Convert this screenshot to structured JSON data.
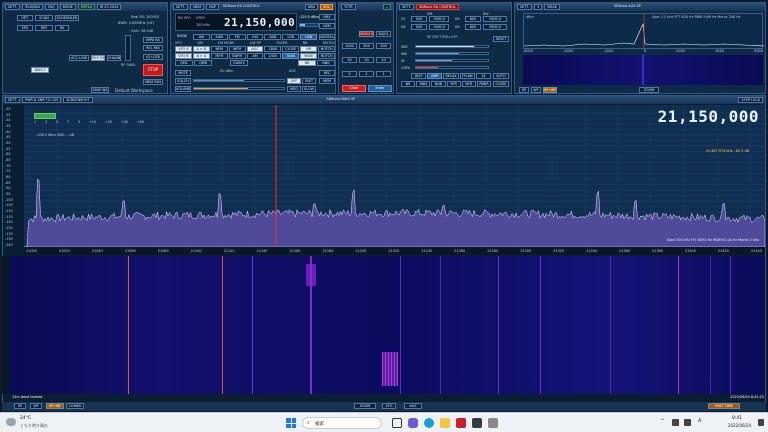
{
  "top_bar": {
    "left_btns": [
      "SETT.",
      "R2IQ3KU",
      "FAQ",
      "MODE"
    ],
    "hardware": "RSP1A",
    "port": "IR 43 2024"
  },
  "sources": {
    "opt": "OPT.",
    "scan": "SCAN",
    "scheduler": "SCHEDULER",
    "row2": [
      "EPG",
      "RP2",
      "RX"
    ],
    "rf_gain": "RF GAIN",
    "meter": [
      "Real SR: 200000",
      "BWM: 0.600MHz (LIF)",
      "Gain: 36.0dB"
    ],
    "bias": "BIAS-T",
    "auto": "AUTO",
    "if_gain_btns": [
      "ACC LOW",
      "REG RA",
      "CHANNEL"
    ],
    "mix_btns": [
      "IMPA RA",
      "REL MIX"
    ],
    "zero": "ZERO",
    "cl": "CLS",
    "lo_lock": "LO LOCK",
    "stop": "STOP",
    "mem": "MEM PAN",
    "nvt": "NVT DCD",
    "workspace": "Default Workspace",
    "save": "SAVE WS"
  },
  "rx_control": {
    "title": "SDRuno RX CONTROL",
    "vfo": "21,150,000",
    "vfo_label": "RX VFO",
    "step_label": "STEP:",
    "step_val": "100 kHz",
    "dbm": "-120.5 dBm",
    "rtx_btn": "NRX",
    "vol": "VOL",
    "mode_btns": [
      "AM",
      "SAM",
      "FM",
      "CW",
      "DSB",
      "LSB",
      "USB"
    ],
    "digital": "DIGITAL",
    "rows": [
      [
        "VFO A",
        "A > B",
        "NFM",
        "WFM",
        "AGC",
        "1800",
        "CLOSE",
        "NR",
        "NOTCH"
      ],
      [
        "VFO B",
        "B > A",
        "MFM",
        "SWFM",
        "AM",
        "2400",
        "3000",
        "WIDE",
        "NOTCH"
      ],
      [
        "QM1",
        "QMR",
        "",
        "CWAFC",
        "",
        "",
        "",
        "NB",
        "NBG"
      ]
    ],
    "sub_labels": [
      "VFO",
      "QM",
      "FM MODE",
      "CW OP",
      "FILTER",
      "NR",
      "NOTCH"
    ],
    "mute": "MUTE",
    "squelch": "SQLCH",
    "volume": "VOLUME",
    "sql_label": "-90 dBm",
    "agc_btns": [
      "OFF",
      "FAST",
      "MED",
      "SLOW"
    ],
    "agc_label": "AGC",
    "pbt": "PBT",
    "ctrl_btns": [
      "RX/REC",
      "WAVE"
    ],
    "right_col": [
      "NRX",
      "NSM",
      "REC",
      "MEM"
    ]
  },
  "numpad": {
    "title": "TCTR",
    "keys": [
      "1000",
      "500",
      "100",
      "50",
      "20",
      "10",
      "5",
      "2",
      "1"
    ],
    "clear": "Clear",
    "enter": "Enter",
    "top": [
      "SN/G15",
      "SN/G1"
    ]
  },
  "cal_panel": {
    "title": "SDRuno RX CONTROL",
    "rows": [
      [
        "SS",
        "500",
        "1500.0",
        "NS",
        "600",
        "2500.0"
      ],
      [
        "NS",
        "500",
        "1500.0",
        "NS",
        "600",
        "2500.0"
      ]
    ],
    "labels": [
      "NM",
      "BW"
    ],
    "section": "RF SOFT ROLLOFF",
    "meters": [
      "NBC",
      "NNI",
      "NI",
      "CNPA"
    ],
    "btns": [
      "DISP",
      "AMP",
      "RELAX",
      "FFLAN",
      "14"
    ],
    "btns2": [
      "NR",
      "RNN",
      "NNB",
      "SFR",
      "NFR",
      "PBNR"
    ],
    "right_col": [
      "RESET",
      "AUTO",
      "CLOSE",
      "NRX",
      "WIDE"
    ]
  },
  "sp_panel": {
    "title": "SDRuno AUX SP",
    "span": "Span 12 kHz",
    "fft": "FFT 628 Hz",
    "rbw": "RBW 9.66 Hz",
    "marks": "Marks 208 Hz",
    "db_top": "dBm",
    "freq_ticks": [
      "-6000",
      "-4000",
      "-2000",
      "0",
      "2000",
      "4000",
      "6000"
    ],
    "bottom": [
      "SP",
      "WF",
      "SP+WF",
      "ZOOM"
    ]
  },
  "main_sp": {
    "title": "SDRuno MAIN SP",
    "left_btns": [
      "SETT.",
      "PWR & SNR TO CSV",
      "SCREENSHOT"
    ],
    "step_lock": "STEP LOCK",
    "big_freq": "21,150,000",
    "smeter_scale": [
      "1",
      "3",
      "5",
      "7",
      "9",
      "+10",
      "+20",
      "+40",
      "+60"
    ],
    "meter_text": "-106.5 dBm   SNR: -- dB",
    "marker": "21,467.974 kHz, -62.5 dB",
    "db_ticks": [
      "-20",
      "-25",
      "-30",
      "-35",
      "-40",
      "-45",
      "-50",
      "-55",
      "-60",
      "-65",
      "-70",
      "-75",
      "-80",
      "-85",
      "-90",
      "-95",
      "-100",
      "-105",
      "-110",
      "-115",
      "-120",
      "-125",
      "-130",
      "-135",
      "-140"
    ],
    "freq_ticks": [
      "21000",
      "21020",
      "21040",
      "21060",
      "21080",
      "21100",
      "21120",
      "21140",
      "21160",
      "21180",
      "21200",
      "21220",
      "21240",
      "21260",
      "21280",
      "21300",
      "21320",
      "21340",
      "21360",
      "21380",
      "21400",
      "21420",
      "21440"
    ],
    "span_info": "Span 500 kHz   FFT 8092 Hz   RBW 61.04 Hz   Marks 2 kHz",
    "band_label": "15m band formed",
    "timestamp": "2022/06/24 8:41:22",
    "bottom_left": [
      "SP",
      "WF",
      "SP+WF",
      "COMBO"
    ],
    "bottom_mid": [
      "ZOOM",
      "VFO",
      "KHZ"
    ],
    "bottom_right": [
      "MULT TIME"
    ]
  },
  "taskbar": {
    "weather_temp": "24°C",
    "weather_desc": "くもり時々晴れ",
    "search": "検索",
    "time": "8:41",
    "date": "2022/06/24",
    "lang": "A"
  },
  "colors": {
    "spectrum_fill": "#5b4fa6",
    "waterfall_bg": "#0b0c5e",
    "vfo_line": "#ff2a2a",
    "accent": "#ff8a1a"
  }
}
